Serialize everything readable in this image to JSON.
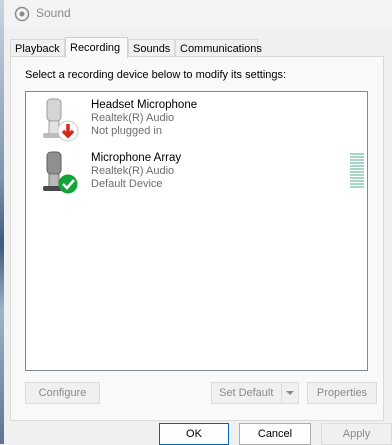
{
  "window": {
    "title": "Sound"
  },
  "tabs": [
    {
      "label": "Playback"
    },
    {
      "label": "Recording"
    },
    {
      "label": "Sounds"
    },
    {
      "label": "Communications"
    }
  ],
  "active_tab": "Recording",
  "instruction": "Select a recording device below to modify its settings:",
  "devices": [
    {
      "name": "Headset Microphone",
      "driver": "Realtek(R) Audio",
      "status": "Not plugged in",
      "status_icon": "red-down-arrow-icon",
      "badge_color": "#d9261c"
    },
    {
      "name": "Microphone Array",
      "driver": "Realtek(R) Audio",
      "status": "Default Device",
      "status_icon": "green-check-icon",
      "badge_color": "#14a33a"
    }
  ],
  "buttons": {
    "configure": "Configure",
    "set_default": "Set Default",
    "properties": "Properties",
    "ok": "OK",
    "cancel": "Cancel",
    "apply": "Apply"
  },
  "colors": {
    "accent": "#0067c0",
    "level_meter": "#a8d5c6"
  }
}
